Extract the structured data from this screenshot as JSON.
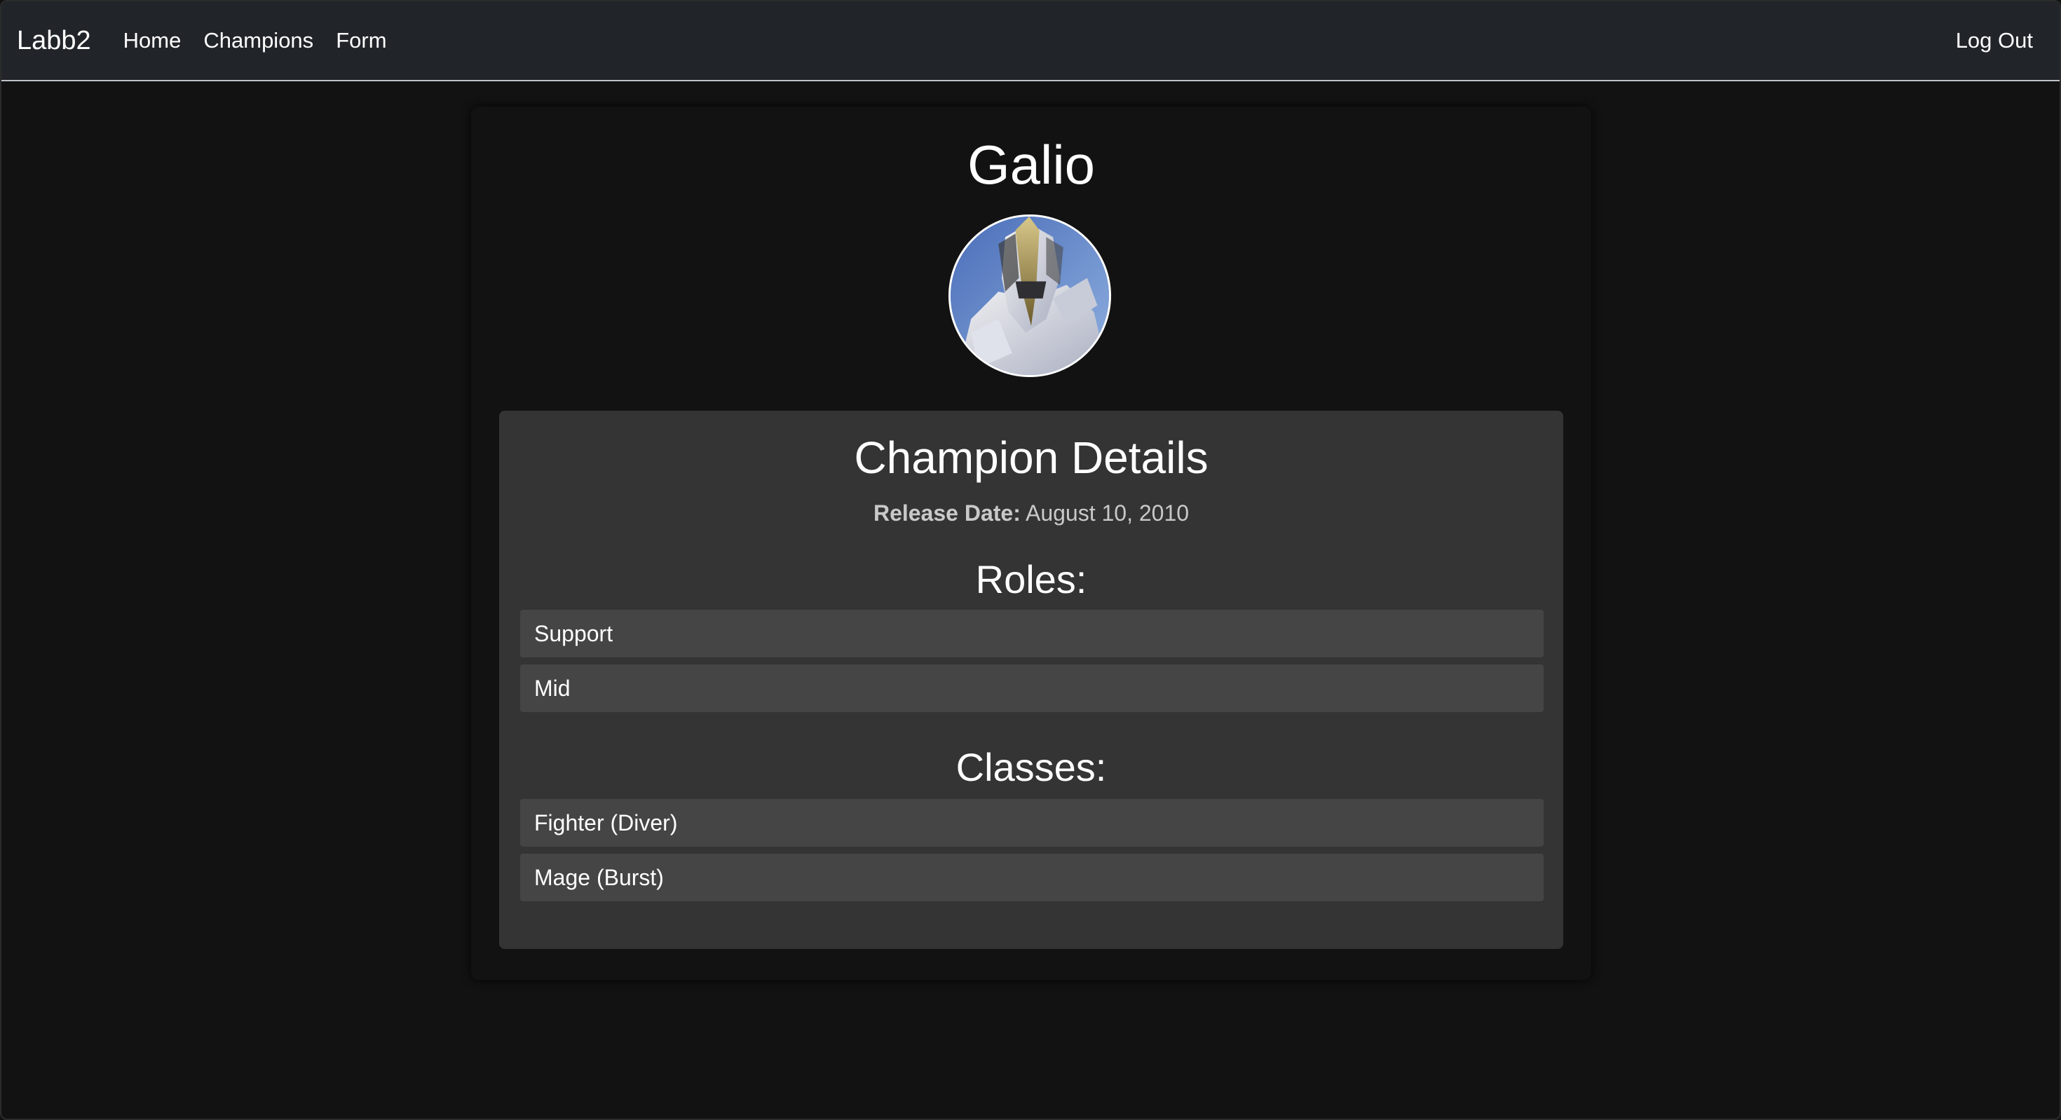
{
  "navbar": {
    "brand": "Labb2",
    "links": [
      "Home",
      "Champions",
      "Form"
    ],
    "logout": "Log Out"
  },
  "champion": {
    "name": "Galio",
    "details_title": "Champion Details",
    "release_label": "Release Date:",
    "release_value": "August 10, 2010",
    "roles_title": "Roles:",
    "roles": [
      "Support",
      "Mid"
    ],
    "classes_title": "Classes:",
    "classes": [
      "Fighter (Diver)",
      "Mage (Burst)"
    ]
  },
  "colors": {
    "page_bg": "#121212",
    "navbar_bg": "#212529",
    "details_bg": "#343434",
    "list_item_bg": "#454545"
  }
}
